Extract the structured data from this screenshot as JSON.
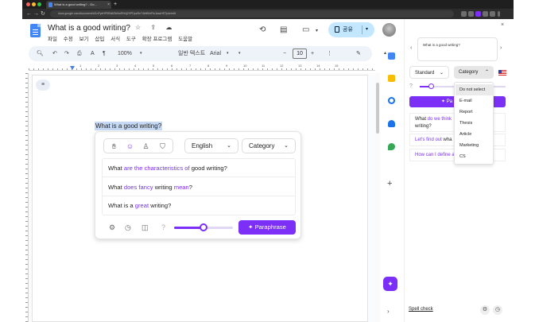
{
  "browser": {
    "tab_title": "What is a good writing? - Go...",
    "url": "docs.google.com/document/d/1nFyeHP0Bh6Ob9mRH4j2VPDpsRe74bft5hrFfoJeacHSTpdr/edit",
    "window_colors": [
      "#ff5f57",
      "#febc2e",
      "#28c840"
    ]
  },
  "docs": {
    "title": "What is a good writing?",
    "title_icons": "☆ ⇪ ☁",
    "menus": [
      "파일",
      "수정",
      "보기",
      "삽입",
      "서식",
      "도구",
      "확장 프로그램",
      "도움말"
    ],
    "share_label": "공유",
    "toolbar": {
      "zoom": "100%",
      "style": "일반 텍스트",
      "font": "Arial",
      "minus": "−",
      "size": "10",
      "plus": "+"
    },
    "ruler_numbers": [
      "1",
      "2",
      "3",
      "4",
      "5",
      "6",
      "7",
      "8",
      "9",
      "10",
      "11",
      "12",
      "13",
      "14",
      "15"
    ],
    "selected_text": "What is a good writing?"
  },
  "popup": {
    "language": "English",
    "category": "Category",
    "suggestions": [
      {
        "parts": [
          "What ",
          "are the characteristics of",
          " good writing?"
        ]
      },
      {
        "parts": [
          "What ",
          "does fancy",
          " writing ",
          "mean",
          "?"
        ]
      },
      {
        "parts": [
          "What is a ",
          "great",
          " writing?"
        ]
      }
    ],
    "slider_level_percent": 50,
    "paraphrase_label": "Paraphrase"
  },
  "panel": {
    "input_text": "What is a good writing?",
    "mode": "Standard",
    "category": "Category",
    "slider_level_percent": 13,
    "paraphrase_label": "Pa",
    "results": [
      {
        "parts": [
          "What ",
          "do we think",
          "",
          "writing?"
        ]
      },
      {
        "parts": [
          "Let's find out",
          " wha"
        ]
      },
      {
        "parts": [
          "How can I define a",
          ""
        ]
      }
    ],
    "category_options": [
      "Do not select",
      "E-mail",
      "Report",
      "Thesis",
      "Article",
      "Marketing",
      "CS"
    ],
    "spell_check": "Spell check"
  },
  "colors": {
    "accent": "#7b2ff7",
    "selection": "#c6daf5",
    "share_bg": "#c2e7ff",
    "docs_blue": "#4285f4"
  }
}
